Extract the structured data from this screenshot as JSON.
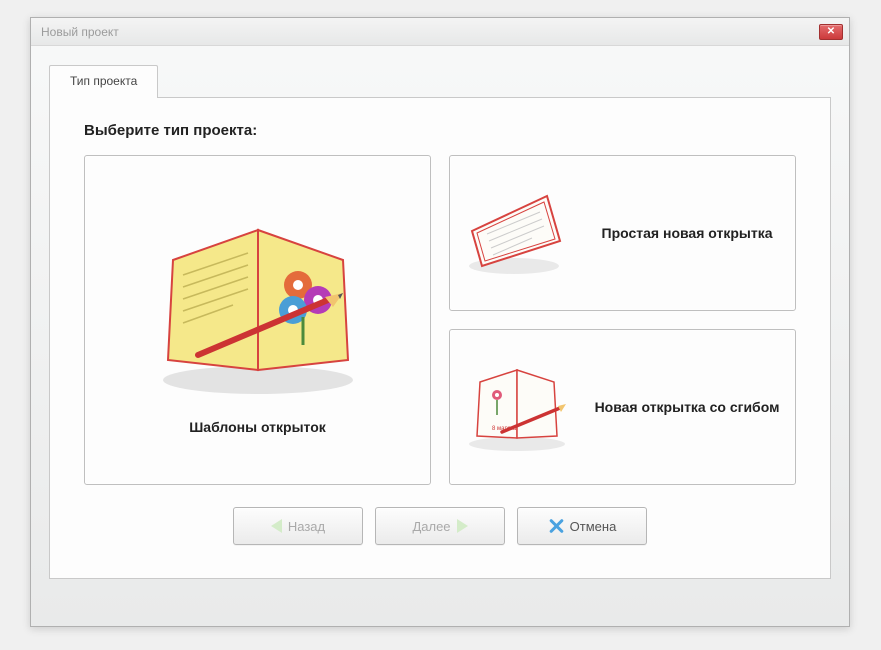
{
  "window": {
    "title": "Новый проект"
  },
  "tab": {
    "label": "Тип проекта"
  },
  "prompt": "Выберите тип проекта:",
  "options": {
    "templates": {
      "label": "Шаблоны открыток"
    },
    "simple": {
      "label": "Простая новая открытка"
    },
    "fold": {
      "label": "Новая открытка со сгибом"
    }
  },
  "buttons": {
    "back": "Назад",
    "next": "Далее",
    "cancel": "Отмена"
  }
}
